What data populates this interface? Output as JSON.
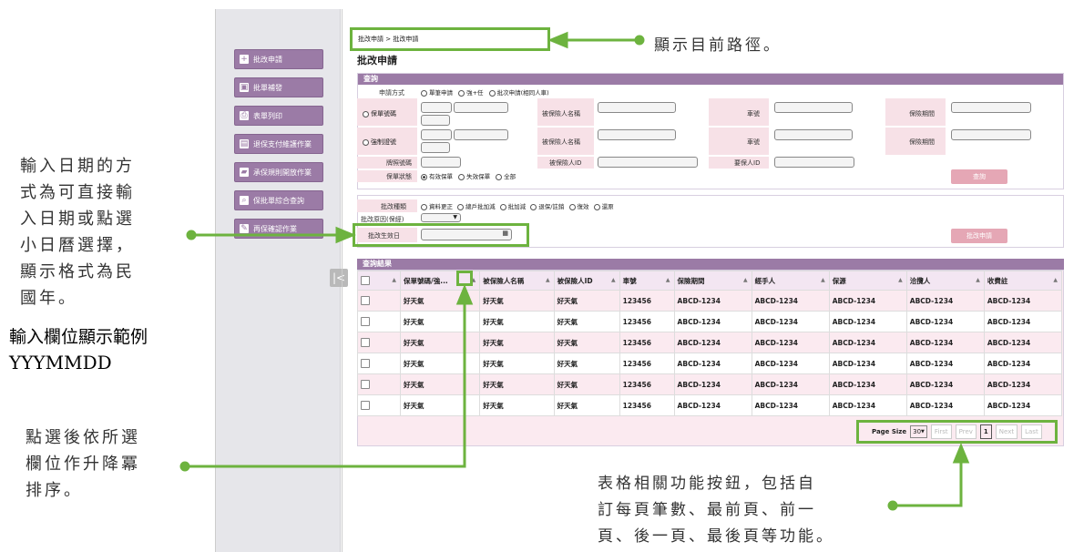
{
  "sidebar": {
    "items": [
      {
        "label": "批改申請",
        "icon": "plus-icon"
      },
      {
        "label": "批單補發",
        "icon": "folder-plus-icon"
      },
      {
        "label": "表單列印",
        "icon": "printer-icon"
      },
      {
        "label": "退保支付維護作業",
        "icon": "document-icon"
      },
      {
        "label": "承保規則開放作業",
        "icon": "briefcase-icon"
      },
      {
        "label": "保批單綜合查詢",
        "icon": "search-icon"
      },
      {
        "label": "再保確認作業",
        "icon": "pen-icon"
      }
    ]
  },
  "breadcrumb": "批改申請 > 批改申請",
  "page_title": "批改申請",
  "query": {
    "header": "查詢",
    "apply_method_label": "申請方式",
    "apply_methods": [
      "單筆申請",
      "強+任",
      "批次申請(相同人車)"
    ],
    "policy_no_label": "保單號碼",
    "compulsory_no_label": "強制證號",
    "insured_name_label": "被保險人名稱",
    "car_no_label": "車號",
    "period_label": "保險期間",
    "plate_label": "牌照號碼",
    "insured_id_label": "被保險人ID",
    "proposer_id_label": "要保人ID",
    "status_label": "保單狀態",
    "statuses": [
      "有效保單",
      "失效保單",
      "全部"
    ],
    "query_button": "查詢"
  },
  "endorse": {
    "type_label": "批改種類",
    "types": [
      "資料更正",
      "總戶批加減",
      "批加減",
      "退保/註銷",
      "復效",
      "還原"
    ],
    "reason_label": "批改原因(保經)",
    "effective_date_label": "批改生效日",
    "apply_button": "批改申請"
  },
  "results": {
    "header": "查詢結果",
    "columns": [
      "保單號碼/強...",
      "被保險人名稱",
      "被保險人ID",
      "車號",
      "保險期間",
      "經手人",
      "保源",
      "洽攬人",
      "收費註"
    ],
    "rows": [
      [
        "好天氣",
        "好天氣",
        "好天氣",
        "123456",
        "ABCD-1234",
        "ABCD-1234",
        "ABCD-1234",
        "ABCD-1234",
        "ABCD-1234"
      ],
      [
        "好天氣",
        "好天氣",
        "好天氣",
        "123456",
        "ABCD-1234",
        "ABCD-1234",
        "ABCD-1234",
        "ABCD-1234",
        "ABCD-1234"
      ],
      [
        "好天氣",
        "好天氣",
        "好天氣",
        "123456",
        "ABCD-1234",
        "ABCD-1234",
        "ABCD-1234",
        "ABCD-1234",
        "ABCD-1234"
      ],
      [
        "好天氣",
        "好天氣",
        "好天氣",
        "123456",
        "ABCD-1234",
        "ABCD-1234",
        "ABCD-1234",
        "ABCD-1234",
        "ABCD-1234"
      ],
      [
        "好天氣",
        "好天氣",
        "好天氣",
        "123456",
        "ABCD-1234",
        "ABCD-1234",
        "ABCD-1234",
        "ABCD-1234",
        "ABCD-1234"
      ],
      [
        "好天氣",
        "好天氣",
        "好天氣",
        "123456",
        "ABCD-1234",
        "ABCD-1234",
        "ABCD-1234",
        "ABCD-1234",
        "ABCD-1234"
      ]
    ]
  },
  "pager": {
    "page_size_label": "Page Size",
    "page_size": "30",
    "first": "First",
    "prev": "Prev",
    "current": "1",
    "next": "Next",
    "last": "Last"
  },
  "annotations": {
    "path_note": "顯示目前路徑。",
    "date_note_lines": [
      "輸入日期的方",
      "式為可直接輸",
      "入日期或點選",
      "小日曆選擇，",
      "顯示格式為民",
      "國年。"
    ],
    "example_line1": "輸入欄位顯示範例",
    "example_line2": "YYYMMDD",
    "sort_note_lines": [
      "點選後依所選",
      "欄位作升降冪",
      "排序。"
    ],
    "pager_note_lines": [
      "表格相關功能按鈕，包括自",
      "訂每頁筆數、最前頁、前一",
      "頁、後一頁、最後頁等功能。"
    ]
  },
  "colors": {
    "accent": "#9b7ba6",
    "highlight": "#6db33f",
    "pink": "#f7e1e7"
  }
}
